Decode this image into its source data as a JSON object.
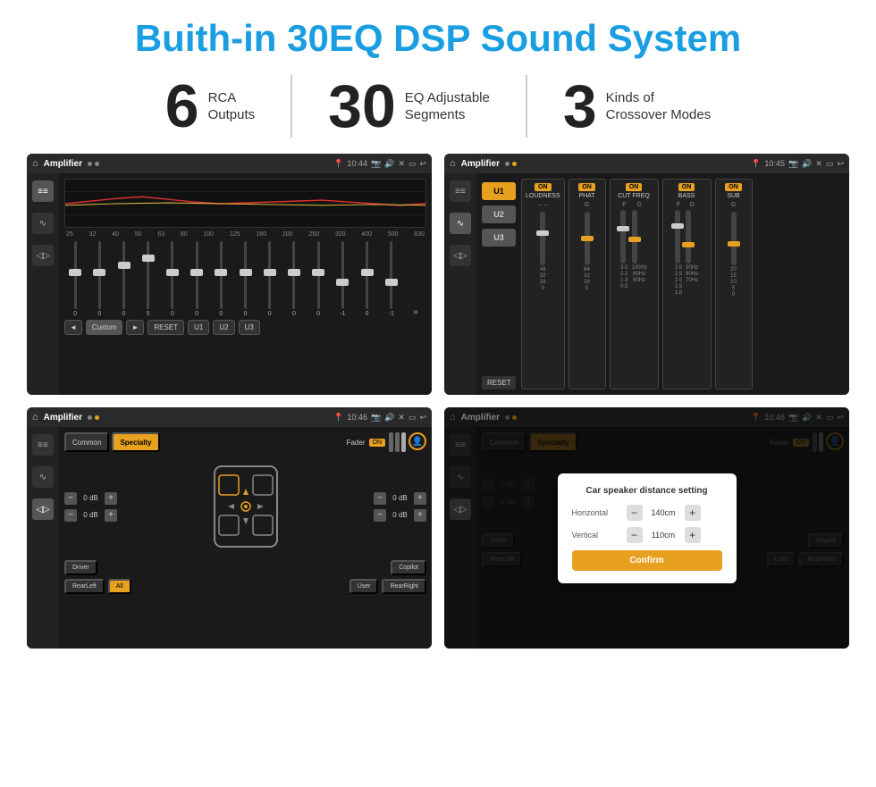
{
  "title": "Buith-in 30EQ DSP Sound System",
  "stats": [
    {
      "number": "6",
      "label_line1": "RCA",
      "label_line2": "Outputs"
    },
    {
      "number": "30",
      "label_line1": "EQ Adjustable",
      "label_line2": "Segments"
    },
    {
      "number": "3",
      "label_line1": "Kinds of",
      "label_line2": "Crossover Modes"
    }
  ],
  "screenshots": [
    {
      "id": "eq-screen",
      "topbar": {
        "title": "Amplifier",
        "time": "10:44"
      },
      "type": "eq"
    },
    {
      "id": "amp-screen",
      "topbar": {
        "title": "Amplifier",
        "time": "10:45"
      },
      "type": "amplifier"
    },
    {
      "id": "speaker-screen",
      "topbar": {
        "title": "Amplifier",
        "time": "10:46"
      },
      "type": "speaker"
    },
    {
      "id": "dialog-screen",
      "topbar": {
        "title": "Amplifier",
        "time": "10:46"
      },
      "type": "dialog"
    }
  ],
  "eq": {
    "frequencies": [
      "25",
      "32",
      "40",
      "50",
      "63",
      "80",
      "100",
      "125",
      "160",
      "200",
      "250",
      "320",
      "400",
      "500",
      "630"
    ],
    "values": [
      "0",
      "0",
      "0",
      "5",
      "0",
      "0",
      "0",
      "0",
      "0",
      "0",
      "0",
      "-1",
      "0",
      "-1"
    ],
    "buttons": [
      "Custom",
      "RESET",
      "U1",
      "U2",
      "U3"
    ]
  },
  "amplifier": {
    "u_buttons": [
      "U1",
      "U2",
      "U3"
    ],
    "modules": [
      {
        "name": "LOUDNESS",
        "on": true
      },
      {
        "name": "PHAT",
        "on": true
      },
      {
        "name": "CUT FREQ",
        "on": true
      },
      {
        "name": "BASS",
        "on": true
      },
      {
        "name": "SUB",
        "on": true
      }
    ],
    "reset_label": "RESET"
  },
  "speaker": {
    "tabs": [
      "Common",
      "Specialty"
    ],
    "active_tab": "Specialty",
    "fader_label": "Fader",
    "fader_on": "ON",
    "db_rows": [
      {
        "value": "0 dB"
      },
      {
        "value": "0 dB"
      },
      {
        "value": "0 dB"
      },
      {
        "value": "0 dB"
      }
    ],
    "bottom_buttons": [
      "Driver",
      "RearLeft",
      "All",
      "User",
      "Copilot",
      "RearRight"
    ]
  },
  "dialog": {
    "title": "Car speaker distance setting",
    "horizontal_label": "Horizontal",
    "horizontal_value": "140cm",
    "vertical_label": "Vertical",
    "vertical_value": "110cm",
    "confirm_label": "Confirm",
    "tabs": [
      "Common",
      "Specialty"
    ],
    "db_values": [
      "0 dB",
      "0 dB"
    ],
    "bottom_buttons": [
      "Driver",
      "RearLeft",
      "All",
      "User",
      "Copilot",
      "RearRight"
    ]
  }
}
